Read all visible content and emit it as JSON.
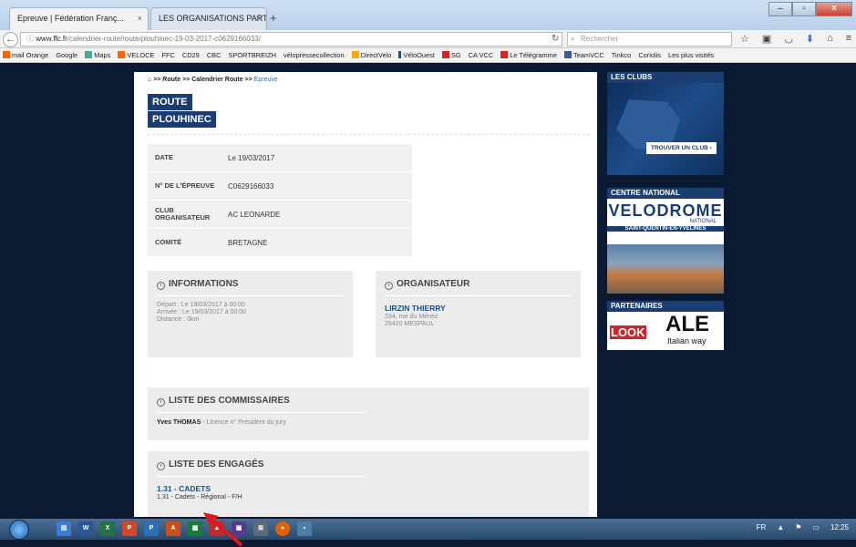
{
  "browser": {
    "tabs": [
      {
        "label": "Epreuve | Fédération Franç..."
      },
      {
        "label": "LES ORGANISATIONS PARTEN..."
      }
    ],
    "url_host": "www.ffc.fr",
    "url_path": "/calendrier-route/route/plouhinec-19-03-2017-c0629166033/",
    "search_placeholder": "Rechercher",
    "bookmarks": [
      "mail Orange",
      "Google",
      "Maps",
      "VELOCE",
      "FFC",
      "CD29",
      "CBC",
      "SPORTBREIZH",
      "vélopressecollection",
      "DirectVelo",
      "VéloOuest",
      "SG",
      "CA VCC",
      "Le Télégramme",
      "TeamVCC",
      "Tinkco",
      "Coriolis",
      "Les plus visités"
    ]
  },
  "page": {
    "breadcrumb": {
      "a": ">> Route >> Calendrier Route >>",
      "current": "Epreuve"
    },
    "title1": "ROUTE",
    "title2": "PLOUHINEC",
    "details": [
      {
        "key": "DATE",
        "value": "Le 19/03/2017"
      },
      {
        "key": "N° DE L'ÉPREUVE",
        "value": "C0629166033"
      },
      {
        "key": "CLUB ORGANISATEUR",
        "value": "AC LEONARDE"
      },
      {
        "key": "COMITÉ",
        "value": "BRETAGNE"
      }
    ],
    "informations": {
      "title": "INFORMATIONS",
      "depart": "Départ : Le 19/03/2017 à 00:00",
      "arrivee": "Arrivée : Le 19/03/2017 à 00:00",
      "distance": "Distance : 0km"
    },
    "organisateur": {
      "title": "ORGANISATEUR",
      "name": "LIRZIN THIERRY",
      "address1": "334, rue du Ménez",
      "address2": "29420 MESPAUL"
    },
    "commissaires": {
      "title": "LISTE DES COMMISSAIRES",
      "name": "Yves THOMAS",
      "detail": " - Licence n° Président du jury"
    },
    "engages": {
      "title": "LISTE DES ENGAGÉS",
      "cat": "1.31 - CADETS",
      "detail": "1.31 - Cadets - Régional - F/H"
    }
  },
  "sidebar": {
    "clubs_title": "LES CLUBS",
    "find_club": "TROUVER UN CLUB",
    "centre_title": "CENTRE NATIONAL",
    "velodrome": "VELODROME",
    "national": "NATIONAL",
    "sqy": "SAINT-QUENTIN-EN-YVELINES",
    "partners_title": "PARTENAIRES",
    "look": "LOOK",
    "ale": "ALE",
    "italian": "Italian way"
  },
  "taskbar": {
    "lang": "FR",
    "time": "12:25"
  }
}
